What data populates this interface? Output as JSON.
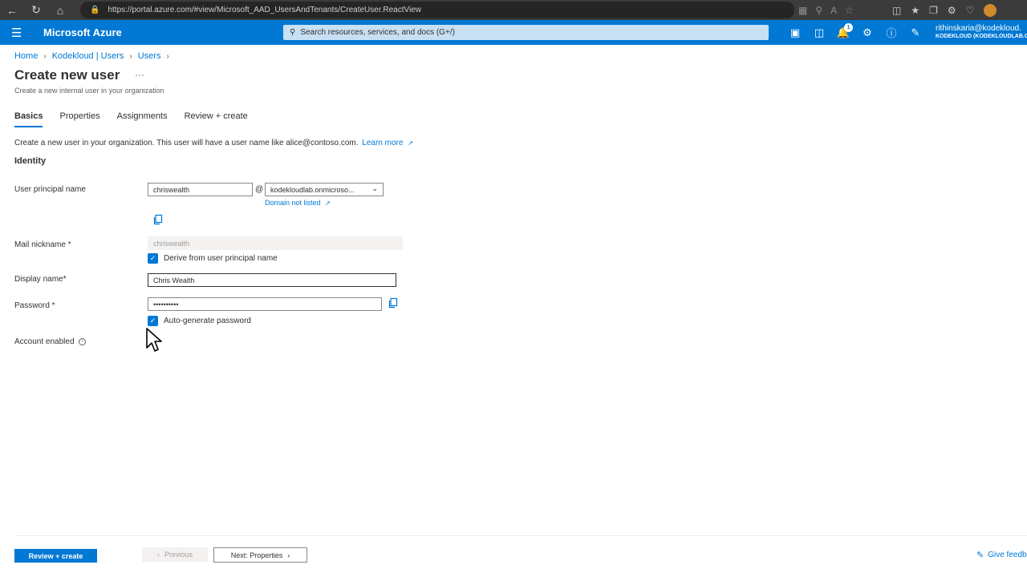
{
  "browser": {
    "url": "https://portal.azure.com/#view/Microsoft_AAD_UsersAndTenants/CreateUser.ReactView"
  },
  "header": {
    "brand": "Microsoft Azure",
    "search_placeholder": "Search resources, services, and docs (G+/)",
    "notification_count": "1",
    "account_name": "rithinskaria@kodekloud.",
    "account_tenant": "KODEKLOUD (KODEKLOUDLAB.O"
  },
  "breadcrumb": [
    "Home",
    "Kodekloud | Users",
    "Users"
  ],
  "page": {
    "title": "Create new user",
    "more": "···",
    "subtitle": "Create a new internal user in your organization"
  },
  "tabs": [
    "Basics",
    "Properties",
    "Assignments",
    "Review + create"
  ],
  "intro": {
    "text": "Create a new user in your organization. This user will have a user name like alice@contoso.com.",
    "link": "Learn more"
  },
  "form": {
    "section": "Identity",
    "upn_label": "User principal name",
    "upn_value": "chriswealth",
    "at": "@",
    "domain_value": "kodekloudlab.onmicroso...",
    "domain_link": "Domain not listed",
    "mail_label": "Mail nickname *",
    "mail_value": "chriswealth",
    "derive_label": "Derive from user principal name",
    "display_label": "Display name*",
    "display_value": "Chris Wealth",
    "password_label": "Password *",
    "password_value": "••••••••••",
    "autogen_label": "Auto-generate password",
    "account_enabled_label": "Account enabled"
  },
  "footer": {
    "review_create": "Review + create",
    "previous": "Previous",
    "next": "Next: Properties",
    "feedback": "Give feedb"
  },
  "colors": {
    "accent": "#0078d4",
    "text": "#323130"
  }
}
